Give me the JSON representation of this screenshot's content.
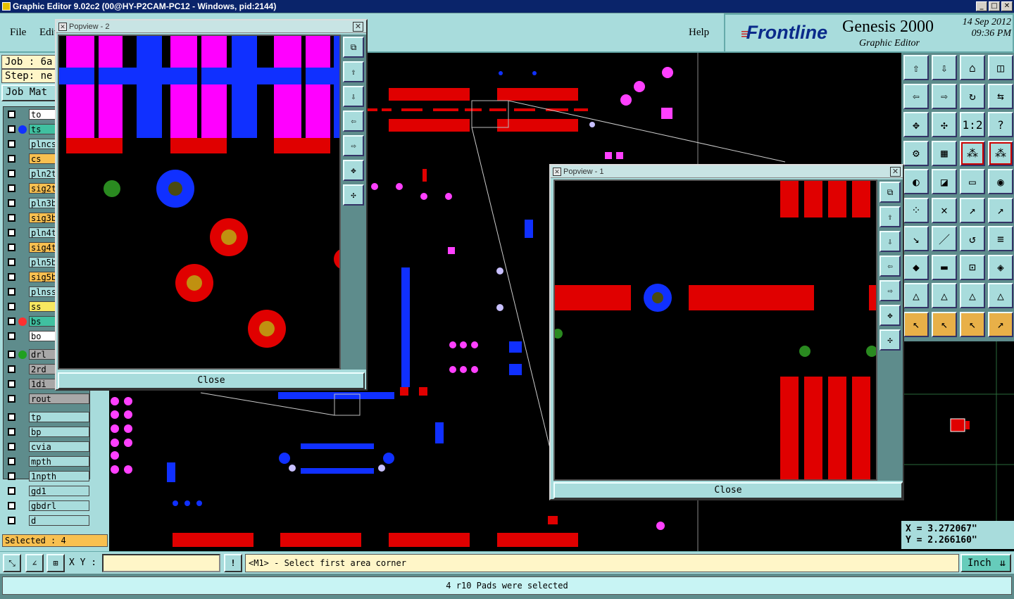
{
  "window": {
    "title": "Graphic Editor 9.02c2 (00@HY-P2CAM-PC12 - Windows, pid:2144)",
    "minimize": "_",
    "maximize": "□",
    "close": "✕"
  },
  "menu": {
    "file": "File",
    "edit": "Edit",
    "help": "Help"
  },
  "branding": {
    "logo": "Frontline",
    "product": "Genesis 2000",
    "subtitle": "Graphic Editor",
    "date": "14 Sep 2012",
    "time": "09:36 PM"
  },
  "left": {
    "job": "Job : 6a",
    "step": "Step: ne",
    "job_matrix": "Job Mat",
    "layers": [
      {
        "name": "to",
        "bg": "#ffffff",
        "dot": ""
      },
      {
        "name": "ts",
        "bg": "#40c0a0",
        "dot": "#1030ff"
      },
      {
        "name": "plncs",
        "bg": "#a8dcdc",
        "dot": ""
      },
      {
        "name": "cs",
        "bg": "#f8c050",
        "dot": ""
      },
      {
        "name": "pln2t",
        "bg": "#a8dcdc",
        "dot": ""
      },
      {
        "name": "sig2t",
        "bg": "#f8c050",
        "dot": ""
      },
      {
        "name": "pln3b",
        "bg": "#a8dcdc",
        "dot": ""
      },
      {
        "name": "sig3b",
        "bg": "#f8c050",
        "dot": ""
      },
      {
        "name": "pln4t",
        "bg": "#a8dcdc",
        "dot": ""
      },
      {
        "name": "sig4t",
        "bg": "#f8c050",
        "dot": ""
      },
      {
        "name": "pln5b",
        "bg": "#a8dcdc",
        "dot": ""
      },
      {
        "name": "sig5b",
        "bg": "#f8c050",
        "dot": ""
      },
      {
        "name": "plnss",
        "bg": "#a8dcdc",
        "dot": ""
      },
      {
        "name": "ss",
        "bg": "#f8e860",
        "dot": ""
      },
      {
        "name": "bs",
        "bg": "#40c0a0",
        "dot": "#ff3030"
      },
      {
        "name": "bo",
        "bg": "#ffffff",
        "dot": ""
      },
      {
        "name": "drl",
        "bg": "#a8a8a8",
        "dot": "#20a020"
      },
      {
        "name": "2rd",
        "bg": "#a8a8a8",
        "dot": ""
      },
      {
        "name": "1di",
        "bg": "#a8a8a8",
        "dot": ""
      },
      {
        "name": "rout",
        "bg": "#a8a8a8",
        "dot": ""
      },
      {
        "name": "tp",
        "bg": "#a8dcdc",
        "dot": ""
      },
      {
        "name": "bp",
        "bg": "#a8dcdc",
        "dot": ""
      },
      {
        "name": "cvia",
        "bg": "#a8dcdc",
        "dot": ""
      },
      {
        "name": "mpth",
        "bg": "#a8dcdc",
        "dot": ""
      },
      {
        "name": "1npth",
        "bg": "#a8dcdc",
        "dot": ""
      },
      {
        "name": "gd1",
        "bg": "#a8dcdc",
        "dot": ""
      },
      {
        "name": "gbdrl",
        "bg": "#a8dcdc",
        "dot": ""
      },
      {
        "name": "d",
        "bg": "#a8dcdc",
        "dot": ""
      }
    ],
    "selected": "Selected : 4"
  },
  "popview2": {
    "title": "Popview - 2",
    "close": "Close"
  },
  "popview1": {
    "title": "Popview - 1",
    "close": "Close"
  },
  "coords": {
    "x": "X = 3.272067\"",
    "y": "Y = 2.266160\""
  },
  "bottom": {
    "xy_label": "X Y :",
    "xy_value": "",
    "prompt": "<M1> - Select first area corner",
    "unit": "Inch",
    "excl": "!"
  },
  "status": "4 r10 Pads were selected",
  "colors": {
    "bg_teal": "#5e8c8c",
    "panel": "#a8dcdc",
    "pad_red": "#ff0000",
    "pad_blue": "#1030ff",
    "pad_magenta": "#ff40ff"
  }
}
